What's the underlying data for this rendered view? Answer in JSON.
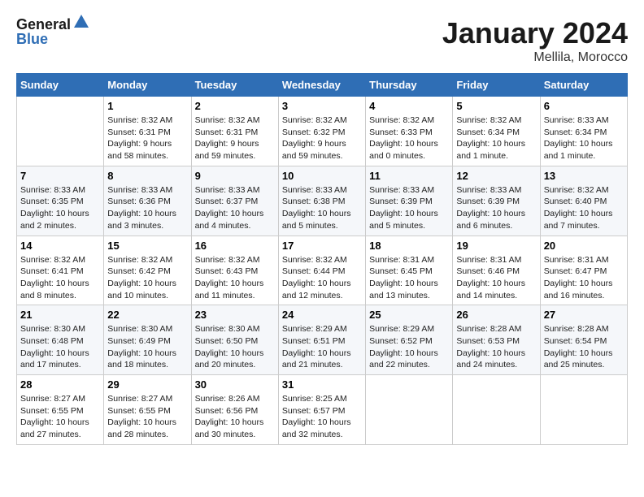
{
  "header": {
    "logo_line1": "General",
    "logo_line2": "Blue",
    "month": "January 2024",
    "location": "Mellila, Morocco"
  },
  "days_of_week": [
    "Sunday",
    "Monday",
    "Tuesday",
    "Wednesday",
    "Thursday",
    "Friday",
    "Saturday"
  ],
  "weeks": [
    [
      {
        "day": "",
        "sunrise": "",
        "sunset": "",
        "daylight": ""
      },
      {
        "day": "1",
        "sunrise": "Sunrise: 8:32 AM",
        "sunset": "Sunset: 6:31 PM",
        "daylight": "Daylight: 9 hours and 58 minutes."
      },
      {
        "day": "2",
        "sunrise": "Sunrise: 8:32 AM",
        "sunset": "Sunset: 6:31 PM",
        "daylight": "Daylight: 9 hours and 59 minutes."
      },
      {
        "day": "3",
        "sunrise": "Sunrise: 8:32 AM",
        "sunset": "Sunset: 6:32 PM",
        "daylight": "Daylight: 9 hours and 59 minutes."
      },
      {
        "day": "4",
        "sunrise": "Sunrise: 8:32 AM",
        "sunset": "Sunset: 6:33 PM",
        "daylight": "Daylight: 10 hours and 0 minutes."
      },
      {
        "day": "5",
        "sunrise": "Sunrise: 8:32 AM",
        "sunset": "Sunset: 6:34 PM",
        "daylight": "Daylight: 10 hours and 1 minute."
      },
      {
        "day": "6",
        "sunrise": "Sunrise: 8:33 AM",
        "sunset": "Sunset: 6:34 PM",
        "daylight": "Daylight: 10 hours and 1 minute."
      }
    ],
    [
      {
        "day": "7",
        "sunrise": "Sunrise: 8:33 AM",
        "sunset": "Sunset: 6:35 PM",
        "daylight": "Daylight: 10 hours and 2 minutes."
      },
      {
        "day": "8",
        "sunrise": "Sunrise: 8:33 AM",
        "sunset": "Sunset: 6:36 PM",
        "daylight": "Daylight: 10 hours and 3 minutes."
      },
      {
        "day": "9",
        "sunrise": "Sunrise: 8:33 AM",
        "sunset": "Sunset: 6:37 PM",
        "daylight": "Daylight: 10 hours and 4 minutes."
      },
      {
        "day": "10",
        "sunrise": "Sunrise: 8:33 AM",
        "sunset": "Sunset: 6:38 PM",
        "daylight": "Daylight: 10 hours and 5 minutes."
      },
      {
        "day": "11",
        "sunrise": "Sunrise: 8:33 AM",
        "sunset": "Sunset: 6:39 PM",
        "daylight": "Daylight: 10 hours and 5 minutes."
      },
      {
        "day": "12",
        "sunrise": "Sunrise: 8:33 AM",
        "sunset": "Sunset: 6:39 PM",
        "daylight": "Daylight: 10 hours and 6 minutes."
      },
      {
        "day": "13",
        "sunrise": "Sunrise: 8:32 AM",
        "sunset": "Sunset: 6:40 PM",
        "daylight": "Daylight: 10 hours and 7 minutes."
      }
    ],
    [
      {
        "day": "14",
        "sunrise": "Sunrise: 8:32 AM",
        "sunset": "Sunset: 6:41 PM",
        "daylight": "Daylight: 10 hours and 8 minutes."
      },
      {
        "day": "15",
        "sunrise": "Sunrise: 8:32 AM",
        "sunset": "Sunset: 6:42 PM",
        "daylight": "Daylight: 10 hours and 10 minutes."
      },
      {
        "day": "16",
        "sunrise": "Sunrise: 8:32 AM",
        "sunset": "Sunset: 6:43 PM",
        "daylight": "Daylight: 10 hours and 11 minutes."
      },
      {
        "day": "17",
        "sunrise": "Sunrise: 8:32 AM",
        "sunset": "Sunset: 6:44 PM",
        "daylight": "Daylight: 10 hours and 12 minutes."
      },
      {
        "day": "18",
        "sunrise": "Sunrise: 8:31 AM",
        "sunset": "Sunset: 6:45 PM",
        "daylight": "Daylight: 10 hours and 13 minutes."
      },
      {
        "day": "19",
        "sunrise": "Sunrise: 8:31 AM",
        "sunset": "Sunset: 6:46 PM",
        "daylight": "Daylight: 10 hours and 14 minutes."
      },
      {
        "day": "20",
        "sunrise": "Sunrise: 8:31 AM",
        "sunset": "Sunset: 6:47 PM",
        "daylight": "Daylight: 10 hours and 16 minutes."
      }
    ],
    [
      {
        "day": "21",
        "sunrise": "Sunrise: 8:30 AM",
        "sunset": "Sunset: 6:48 PM",
        "daylight": "Daylight: 10 hours and 17 minutes."
      },
      {
        "day": "22",
        "sunrise": "Sunrise: 8:30 AM",
        "sunset": "Sunset: 6:49 PM",
        "daylight": "Daylight: 10 hours and 18 minutes."
      },
      {
        "day": "23",
        "sunrise": "Sunrise: 8:30 AM",
        "sunset": "Sunset: 6:50 PM",
        "daylight": "Daylight: 10 hours and 20 minutes."
      },
      {
        "day": "24",
        "sunrise": "Sunrise: 8:29 AM",
        "sunset": "Sunset: 6:51 PM",
        "daylight": "Daylight: 10 hours and 21 minutes."
      },
      {
        "day": "25",
        "sunrise": "Sunrise: 8:29 AM",
        "sunset": "Sunset: 6:52 PM",
        "daylight": "Daylight: 10 hours and 22 minutes."
      },
      {
        "day": "26",
        "sunrise": "Sunrise: 8:28 AM",
        "sunset": "Sunset: 6:53 PM",
        "daylight": "Daylight: 10 hours and 24 minutes."
      },
      {
        "day": "27",
        "sunrise": "Sunrise: 8:28 AM",
        "sunset": "Sunset: 6:54 PM",
        "daylight": "Daylight: 10 hours and 25 minutes."
      }
    ],
    [
      {
        "day": "28",
        "sunrise": "Sunrise: 8:27 AM",
        "sunset": "Sunset: 6:55 PM",
        "daylight": "Daylight: 10 hours and 27 minutes."
      },
      {
        "day": "29",
        "sunrise": "Sunrise: 8:27 AM",
        "sunset": "Sunset: 6:55 PM",
        "daylight": "Daylight: 10 hours and 28 minutes."
      },
      {
        "day": "30",
        "sunrise": "Sunrise: 8:26 AM",
        "sunset": "Sunset: 6:56 PM",
        "daylight": "Daylight: 10 hours and 30 minutes."
      },
      {
        "day": "31",
        "sunrise": "Sunrise: 8:25 AM",
        "sunset": "Sunset: 6:57 PM",
        "daylight": "Daylight: 10 hours and 32 minutes."
      },
      {
        "day": "",
        "sunrise": "",
        "sunset": "",
        "daylight": ""
      },
      {
        "day": "",
        "sunrise": "",
        "sunset": "",
        "daylight": ""
      },
      {
        "day": "",
        "sunrise": "",
        "sunset": "",
        "daylight": ""
      }
    ]
  ]
}
